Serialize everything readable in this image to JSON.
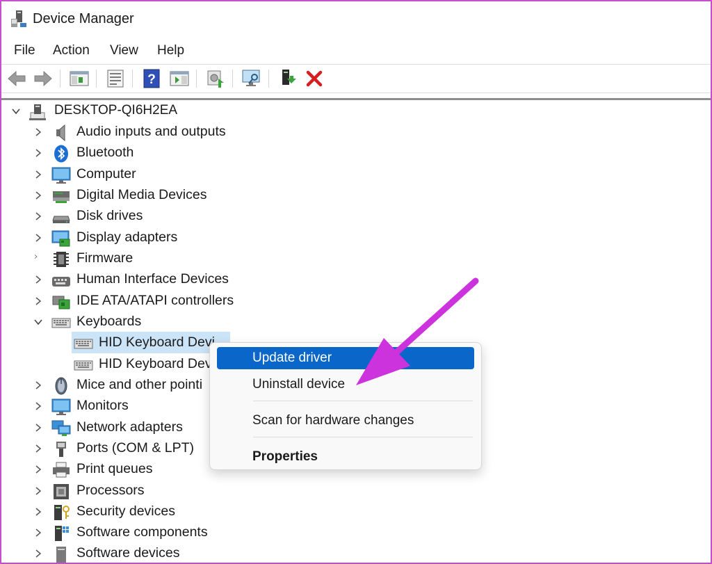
{
  "window": {
    "title": "Device Manager"
  },
  "menu": [
    {
      "label": "File"
    },
    {
      "label": "Action"
    },
    {
      "label": "View"
    },
    {
      "label": "Help"
    }
  ],
  "toolbar": {
    "buttons": [
      {
        "icon": "back-arrow-icon"
      },
      {
        "icon": "forward-arrow-icon"
      },
      {
        "icon": "show-hide-console-tree-icon"
      },
      {
        "icon": "properties-sheet-icon"
      },
      {
        "icon": "help-icon"
      },
      {
        "icon": "show-action-pane-icon"
      },
      {
        "icon": "update-driver-icon"
      },
      {
        "icon": "scan-hardware-changes-icon"
      },
      {
        "icon": "enable-device-icon"
      },
      {
        "icon": "uninstall-device-icon"
      }
    ]
  },
  "tree": {
    "root": {
      "label": "DESKTOP-QI6H2EA",
      "expanded": true,
      "icon": "computer-tower-icon"
    },
    "categories": [
      {
        "label": "Audio inputs and outputs",
        "icon": "speaker-icon"
      },
      {
        "label": "Bluetooth",
        "icon": "bluetooth-icon"
      },
      {
        "label": "Computer",
        "icon": "monitor-icon"
      },
      {
        "label": "Digital Media Devices",
        "icon": "media-device-icon"
      },
      {
        "label": "Disk drives",
        "icon": "disk-drive-icon"
      },
      {
        "label": "Display adapters",
        "icon": "display-adapter-icon"
      },
      {
        "label": "Firmware",
        "icon": "firmware-chip-icon"
      },
      {
        "label": "Human Interface Devices",
        "icon": "hid-icon"
      },
      {
        "label": "IDE ATA/ATAPI controllers",
        "icon": "ide-controller-icon"
      },
      {
        "label": "Keyboards",
        "icon": "keyboard-icon",
        "expanded": true,
        "children": [
          {
            "label": "HID Keyboard Devi",
            "selected": true
          },
          {
            "label": "HID Keyboard Dev"
          }
        ]
      },
      {
        "label": "Mice and other pointi",
        "icon": "mouse-icon"
      },
      {
        "label": "Monitors",
        "icon": "monitor-icon"
      },
      {
        "label": "Network adapters",
        "icon": "network-adapter-icon"
      },
      {
        "label": "Ports (COM & LPT)",
        "icon": "port-icon"
      },
      {
        "label": "Print queues",
        "icon": "printer-icon"
      },
      {
        "label": "Processors",
        "icon": "processor-icon"
      },
      {
        "label": "Security devices",
        "icon": "security-device-icon"
      },
      {
        "label": "Software components",
        "icon": "software-component-icon"
      },
      {
        "label": "Software devices",
        "icon": "software-device-icon"
      }
    ]
  },
  "context_menu": {
    "items": [
      {
        "label": "Update driver",
        "highlighted": true
      },
      {
        "label": "Uninstall device"
      },
      {
        "label": "Scan for hardware changes"
      },
      {
        "label": "Properties",
        "bold": true
      }
    ]
  },
  "colors": {
    "frame_border": "#c64fc9",
    "selection": "#cce4f7",
    "menu_highlight": "#0a67c9",
    "annotation_arrow": "#cc33dd",
    "uninstall_red": "#d61f1f"
  }
}
